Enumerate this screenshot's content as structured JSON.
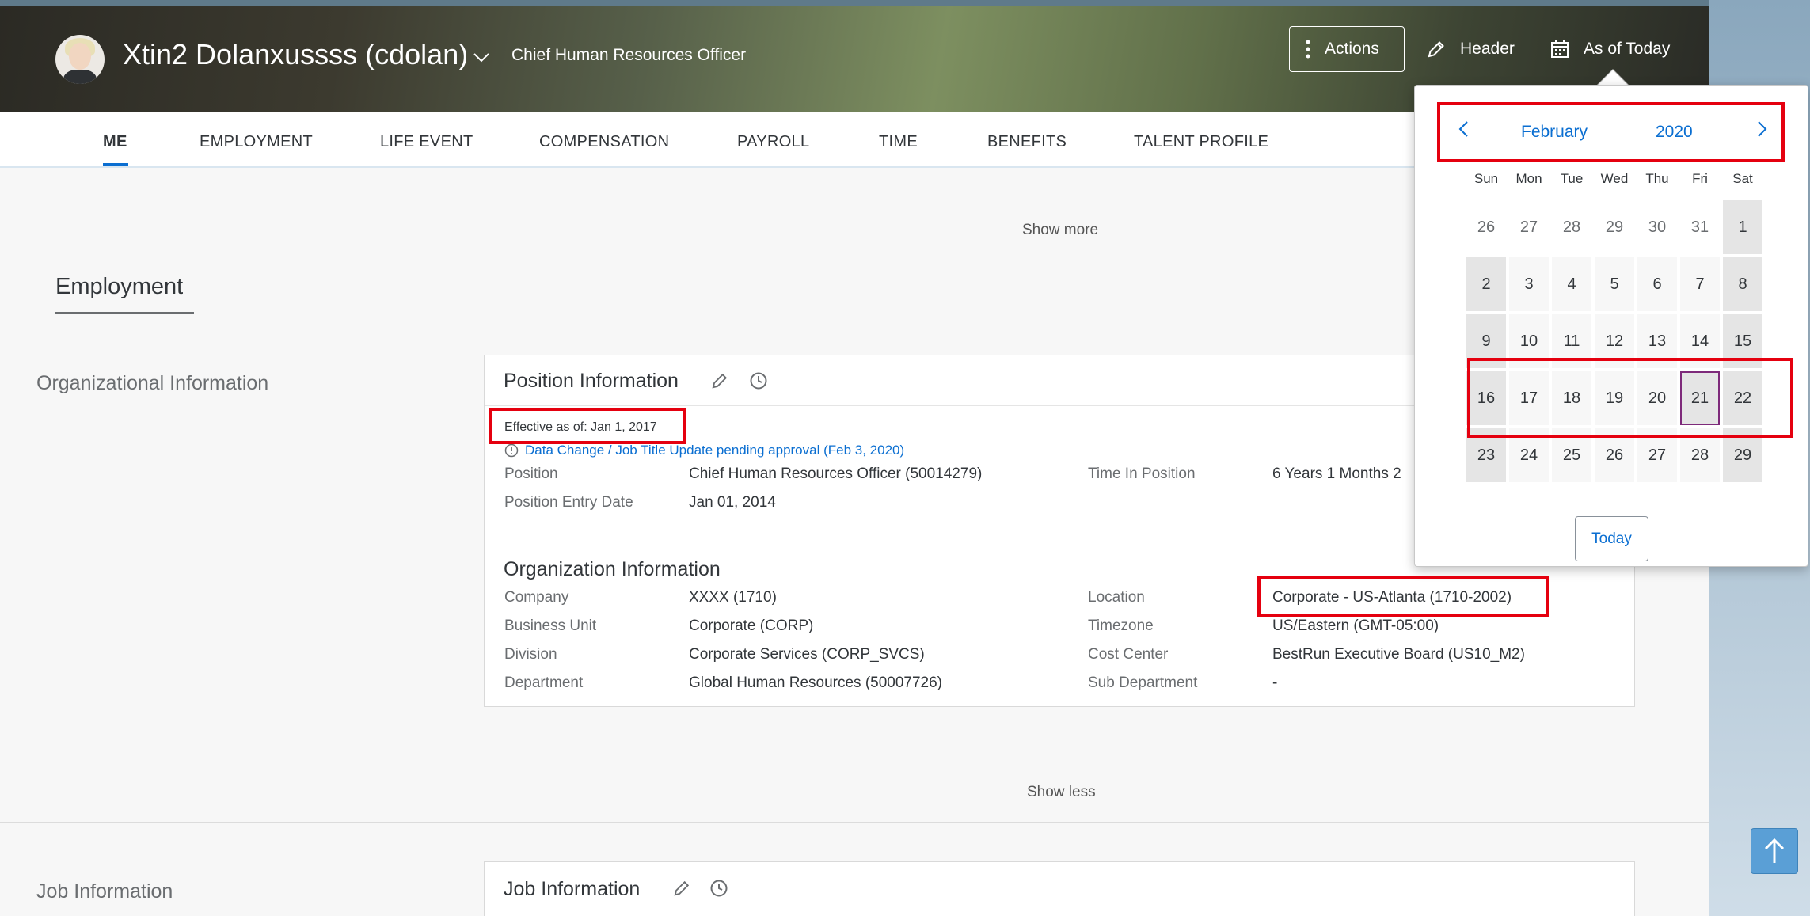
{
  "header": {
    "employee_name": "Xtin2 Dolanxussss (cdolan)",
    "employee_title": "Chief Human Resources Officer",
    "actions_label": "Actions",
    "header_label": "Header",
    "as_of_label": "As of Today"
  },
  "tabs": [
    {
      "label": "ME",
      "active": true
    },
    {
      "label": "EMPLOYMENT"
    },
    {
      "label": "LIFE EVENT"
    },
    {
      "label": "COMPENSATION"
    },
    {
      "label": "PAYROLL"
    },
    {
      "label": "TIME"
    },
    {
      "label": "BENEFITS"
    },
    {
      "label": "TALENT PROFILE"
    }
  ],
  "main": {
    "show_more": "Show more",
    "show_less": "Show less",
    "section_title": "Employment",
    "org_section_label": "Organizational Information",
    "job_section_label": "Job Information"
  },
  "position_card": {
    "title": "Position Information",
    "effective": "Effective as of: Jan 1, 2017",
    "pending": "Data Change / Job Title Update pending approval (Feb 3, 2020)",
    "fields": {
      "position_label": "Position",
      "position_value": "Chief Human Resources Officer (50014279)",
      "time_in_position_label": "Time In Position",
      "time_in_position_value": "6 Years 1 Months 2",
      "entry_date_label": "Position Entry Date",
      "entry_date_value": "Jan 01, 2014"
    },
    "org_title": "Organization Information",
    "org": {
      "company_label": "Company",
      "company_value": "XXXX (1710)",
      "location_label": "Location",
      "location_value": "Corporate - US-Atlanta (1710-2002)",
      "bu_label": "Business Unit",
      "bu_value": "Corporate (CORP)",
      "tz_label": "Timezone",
      "tz_value": "US/Eastern (GMT-05:00)",
      "division_label": "Division",
      "division_value": "Corporate Services (CORP_SVCS)",
      "cc_label": "Cost Center",
      "cc_value": "BestRun Executive Board (US10_M2)",
      "dept_label": "Department",
      "dept_value": "Global Human Resources (50007726)",
      "subdept_label": "Sub Department",
      "subdept_value": "-"
    }
  },
  "job_card": {
    "title": "Job Information"
  },
  "calendar": {
    "month": "February",
    "year": "2020",
    "weekdays": [
      "Sun",
      "Mon",
      "Tue",
      "Wed",
      "Thu",
      "Fri",
      "Sat"
    ],
    "weeks": [
      [
        "26",
        "27",
        "28",
        "29",
        "30",
        "31",
        "1"
      ],
      [
        "2",
        "3",
        "4",
        "5",
        "6",
        "7",
        "8"
      ],
      [
        "9",
        "10",
        "11",
        "12",
        "13",
        "14",
        "15"
      ],
      [
        "16",
        "17",
        "18",
        "19",
        "20",
        "21",
        "22"
      ],
      [
        "23",
        "24",
        "25",
        "26",
        "27",
        "28",
        "29"
      ]
    ],
    "selected_day": "21",
    "today_label": "Today"
  },
  "colors": {
    "accent": "#0a6ed1",
    "highlight": "#e5000f",
    "selected_border": "#7d2a7a"
  }
}
